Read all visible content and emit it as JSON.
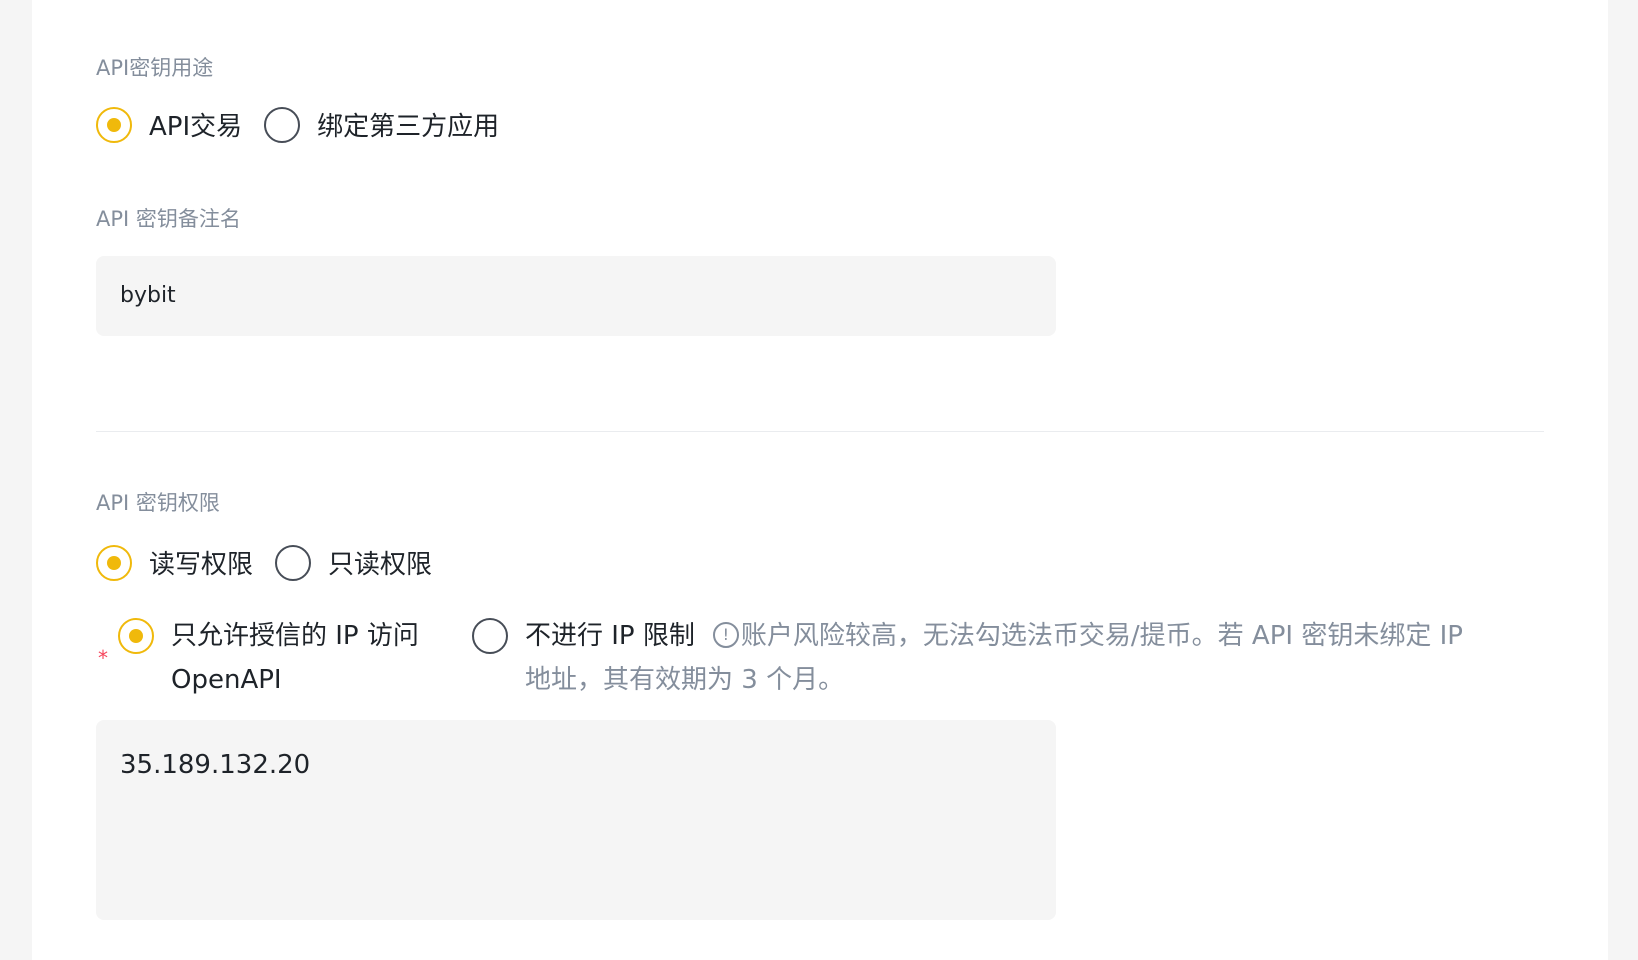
{
  "usage": {
    "label": "API密钥用途",
    "options": [
      {
        "label": "API交易",
        "checked": true
      },
      {
        "label": "绑定第三方应用",
        "checked": false
      }
    ]
  },
  "note": {
    "label": "API 密钥备注名",
    "value": "bybit"
  },
  "permission": {
    "label": "API 密钥权限",
    "options": [
      {
        "label": "读写权限",
        "checked": true
      },
      {
        "label": "只读权限",
        "checked": false
      }
    ]
  },
  "ip": {
    "required_mark": "*",
    "trusted_label_line1": "只允许授信的 IP 访问",
    "trusted_label_line2": "OpenAPI",
    "no_limit_label": "不进行 IP 限制",
    "info_glyph": "!",
    "warning_line1": "账户风险较高，无法勾选法币交易/提币。若 API 密钥未绑定 IP",
    "warning_line2": "地址，其有效期为 3 个月。",
    "value": "35.189.132.20"
  },
  "colors": {
    "accent": "#f0b90b",
    "muted": "#848e9c",
    "required": "#f6465d",
    "input_bg": "#f5f5f5"
  }
}
